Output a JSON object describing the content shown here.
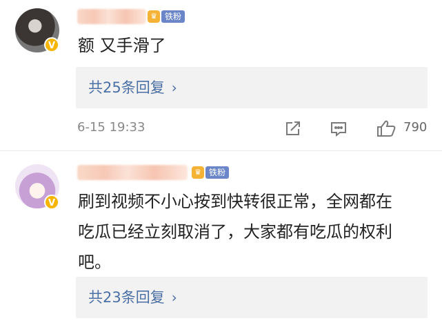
{
  "comments": [
    {
      "fan_badge": "铁粉",
      "text": "额 又手滑了",
      "reply_link": "共25条回复",
      "time": "6-15 19:33",
      "likes": "790"
    },
    {
      "fan_badge": "铁粉",
      "text_lines": [
        "刷到视频不小心按到快转很正常，全网都在",
        "吃瓜已经立刻取消了，大家都有吃瓜的权利",
        "吧。"
      ],
      "reply_link": "共23条回复"
    }
  ],
  "icons": {
    "verified": "verified-badge-icon",
    "share": "share-icon",
    "comment": "comment-icon",
    "like": "thumbs-up-icon",
    "reply_chevron": "chevron-right-icon"
  },
  "colors": {
    "link": "#4a6fa5",
    "verified": "#f6b500",
    "fan_badge": "#6b86c8",
    "reply_bg": "#f2f2f2"
  }
}
